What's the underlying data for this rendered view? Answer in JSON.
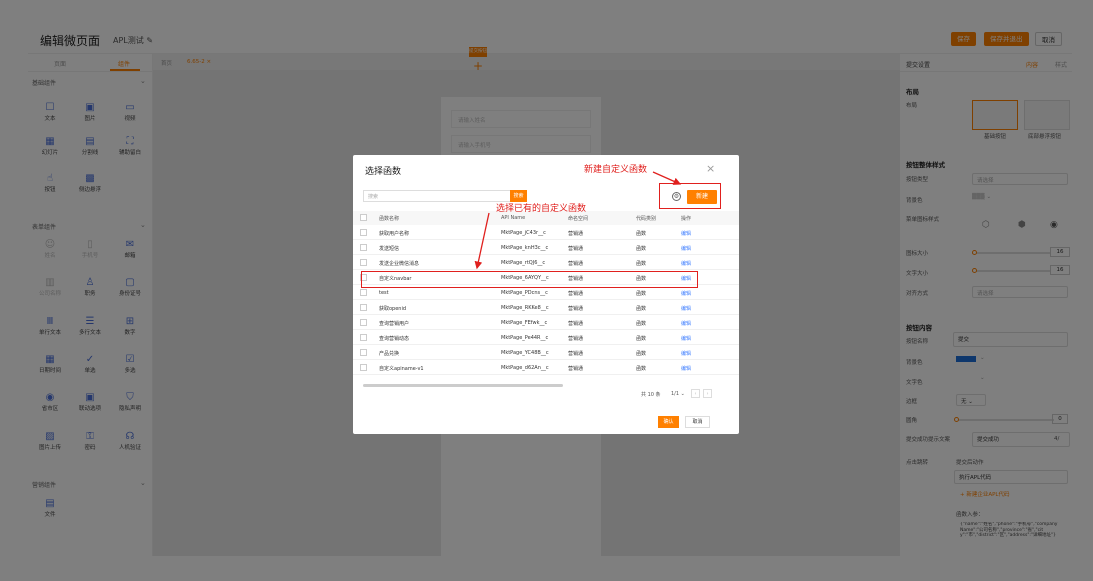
{
  "header": {
    "title": "编辑微页面",
    "subtitle": "APL测试",
    "save_label": "保存",
    "save_exit_label": "保存并退出",
    "cancel_label": "取消"
  },
  "left_panel": {
    "tabs": [
      "页面",
      "组件"
    ],
    "sections": [
      {
        "label": "基础组件",
        "items": [
          {
            "label": "文本",
            "icon": "text-icon"
          },
          {
            "label": "图片",
            "icon": "image-icon"
          },
          {
            "label": "视频",
            "icon": "video-icon"
          },
          {
            "label": "幻灯片",
            "icon": "slideshow-icon"
          },
          {
            "label": "分割线",
            "icon": "divider-icon"
          },
          {
            "label": "辅助留白",
            "icon": "whitespace-icon"
          },
          {
            "label": "按钮",
            "icon": "button-icon"
          },
          {
            "label": "侧边悬浮",
            "icon": "float-icon"
          }
        ]
      },
      {
        "label": "表单组件",
        "items": [
          {
            "label": "姓名",
            "icon": "person-icon"
          },
          {
            "label": "手机号",
            "icon": "phone-icon"
          },
          {
            "label": "邮箱",
            "icon": "mail-icon"
          },
          {
            "label": "公司名称",
            "icon": "company-icon"
          },
          {
            "label": "职务",
            "icon": "job-icon"
          },
          {
            "label": "身份证号",
            "icon": "id-card-icon"
          },
          {
            "label": "单行文本",
            "icon": "single-line-icon"
          },
          {
            "label": "多行文本",
            "icon": "multi-line-icon"
          },
          {
            "label": "数字",
            "icon": "number-icon"
          },
          {
            "label": "日期时间",
            "icon": "calendar-icon"
          },
          {
            "label": "单选",
            "icon": "radio-icon"
          },
          {
            "label": "多选",
            "icon": "checkbox-icon"
          },
          {
            "label": "省市区",
            "icon": "location-icon"
          },
          {
            "label": "联动选项",
            "icon": "linked-icon"
          },
          {
            "label": "隐私声明",
            "icon": "privacy-icon"
          },
          {
            "label": "图片上传",
            "icon": "upload-icon"
          },
          {
            "label": "密码",
            "icon": "lock-icon"
          },
          {
            "label": "人机验证",
            "icon": "captcha-icon"
          }
        ]
      },
      {
        "label": "营销组件",
        "items": [
          {
            "label": "文件",
            "icon": "file-icon"
          }
        ]
      }
    ]
  },
  "canvas": {
    "tabs": [
      "首页",
      "6.65-2"
    ],
    "placeholders": [
      "请输入姓名",
      "请输入手机号"
    ],
    "submit_tag": "提交按钮"
  },
  "right_panel": {
    "title": "提交设置",
    "tabs": [
      "内容",
      "样式"
    ],
    "layout_title": "布局",
    "layout_label": "布局",
    "layout_options": [
      "基础按钮",
      "底部悬浮按钮"
    ],
    "button_style_title": "按钮整体样式",
    "button_type_label": "按钮类型",
    "select_placeholder": "请选择",
    "bg_color_label": "背景色",
    "icon_style_label": "菜单图标样式",
    "icon_size_label": "图标大小",
    "icon_size_value": "16",
    "font_size_label": "文字大小",
    "font_size_value": "16",
    "align_label": "对齐方式",
    "button_content_title": "按钮内容",
    "button_name_label": "按钮名称",
    "button_name_value": "提交",
    "content_bg_label": "背景色",
    "text_color_label": "文字色",
    "border_label": "边框",
    "border_value": "无",
    "radius_label": "圆角",
    "radius_value": "0",
    "success_label": "提交成功提示文案",
    "success_value": "提交成功",
    "success_count": "4/",
    "jump_label": "点击跳转",
    "submit_action_label": "提交后动作",
    "run_apl_value": "执行APL代码",
    "add_apl_link": "+ 新建企业APL代码",
    "params_label": "函数入参：",
    "params_value": "{\"name\":\"姓名\",\"phone\":\"手机号\",\"companyName\":\"公司名称\",\"province\":\"省\",\"city\":\"市\",\"district\":\"区\",\"address\":\"详细地址\"}"
  },
  "dialog": {
    "title": "选择函数",
    "search_placeholder": "搜索",
    "search_button": "搜索",
    "new_button": "新建",
    "columns": [
      "函数名称",
      "API Name",
      "命名空间",
      "代码类别",
      "操作"
    ],
    "rows": [
      {
        "name": "获取用户名称",
        "api": "MktPage_jC43r__c",
        "ns": "营销通",
        "cat": "函数",
        "op": "编辑"
      },
      {
        "name": "发送短信",
        "api": "MktPage_knH3c__c",
        "ns": "营销通",
        "cat": "函数",
        "op": "编辑"
      },
      {
        "name": "发送企业微信消息",
        "api": "MktPage_rtQJ6__c",
        "ns": "营销通",
        "cat": "函数",
        "op": "编辑"
      },
      {
        "name": "自定义navbar",
        "api": "MktPage_6AYQY__c",
        "ns": "营销通",
        "cat": "函数",
        "op": "编辑"
      },
      {
        "name": "test",
        "api": "MktPage_PDcns__c",
        "ns": "营销通",
        "cat": "函数",
        "op": "编辑"
      },
      {
        "name": "获取openid",
        "api": "MktPage_RKKe8__c",
        "ns": "营销通",
        "cat": "函数",
        "op": "编辑"
      },
      {
        "name": "查询营销用户",
        "api": "MktPage_FEfwk__c",
        "ns": "营销通",
        "cat": "函数",
        "op": "编辑"
      },
      {
        "name": "查询营销动态",
        "api": "MktPage_Pe44R__c",
        "ns": "营销通",
        "cat": "函数",
        "op": "编辑"
      },
      {
        "name": "产品兑换",
        "api": "MktPage_YC48B__c",
        "ns": "营销通",
        "cat": "函数",
        "op": "编辑"
      },
      {
        "name": "自定义apiname-v1",
        "api": "MktPage_d62An__c",
        "ns": "营销通",
        "cat": "函数",
        "op": "编辑"
      }
    ],
    "total": "共 10 条",
    "page": "1/1",
    "ok_button": "确认",
    "cancel_button": "取消"
  },
  "annotations": {
    "new_function": "新建自定义函数",
    "select_existing": "选择已有的自定义函数"
  },
  "colors": {
    "accent": "#ff8000",
    "annotation": "#e0201e",
    "link": "#3b7cff",
    "primary_icon": "#4a6fd8"
  }
}
